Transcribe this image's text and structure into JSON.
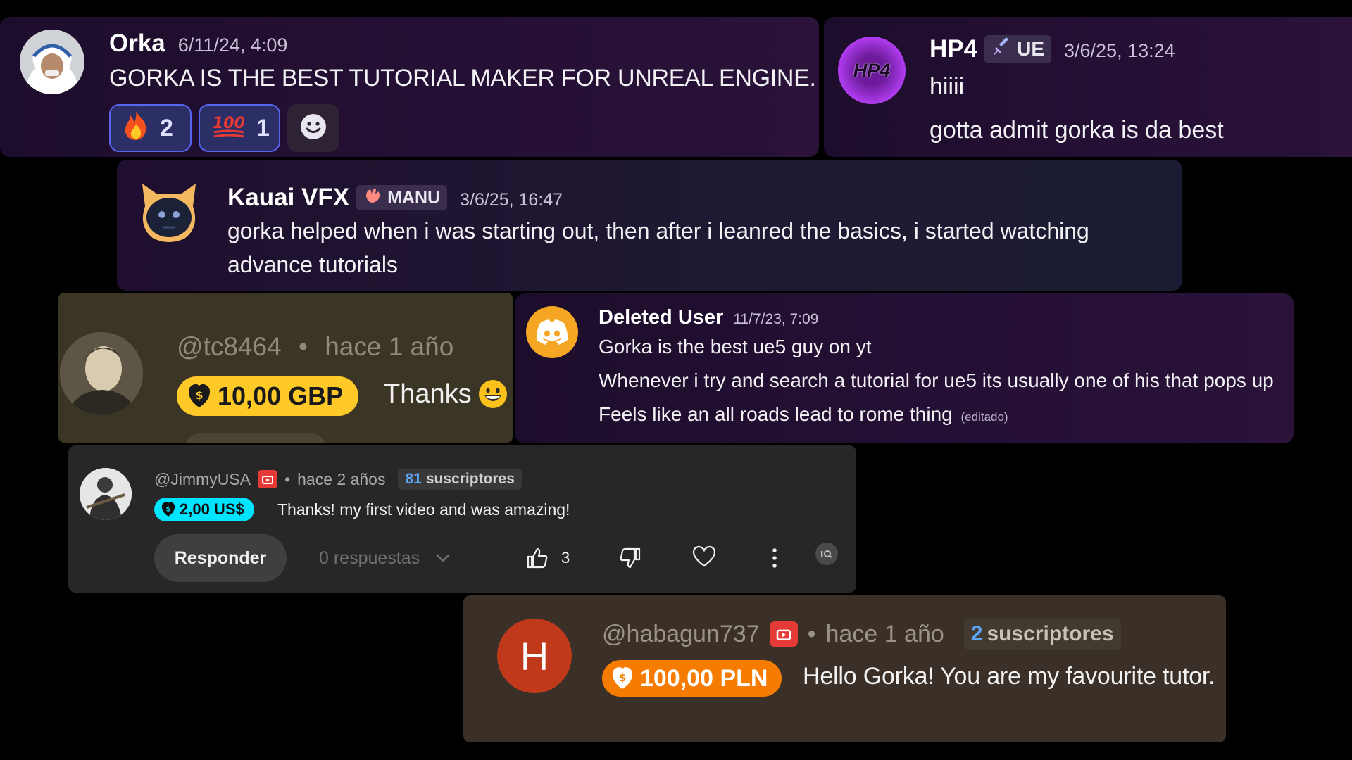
{
  "orka": {
    "name": "Orka",
    "timestamp": "6/11/24, 4:09",
    "message": "GORKA IS THE BEST TUTORIAL MAKER FOR UNREAL ENGINE.",
    "reactions": [
      {
        "icon": "fire-icon",
        "count": "2"
      },
      {
        "icon": "hundred-points-icon",
        "count": "1"
      }
    ]
  },
  "hp4": {
    "name": "HP4",
    "avatar_text": "HP4",
    "tag_icon": "sword-icon",
    "tag": "UE",
    "timestamp": "3/6/25, 13:24",
    "lines": [
      "hiiii",
      "gotta admit gorka is da best"
    ]
  },
  "kauai": {
    "name": "Kauai VFX",
    "tag_icon": "hand-icon",
    "tag": "MANU",
    "timestamp": "3/6/25, 16:47",
    "lines": [
      "gorka helped when i was starting out, then after i leanred the basics, i started watching",
      "advance tutorials"
    ]
  },
  "tc8464": {
    "handle": "@tc8464",
    "dot": "•",
    "time": "hace 1 año",
    "donation": "10,00 GBP",
    "message": "Thanks",
    "emoji": "grinning-face-icon"
  },
  "deleted_user": {
    "name": "Deleted User",
    "timestamp": "11/7/23, 7:09",
    "lines": [
      "Gorka is the best ue5 guy on yt",
      "Whenever i try and search a tutorial for ue5 its usually one of his that pops up",
      "Feels like an all roads lead to rome thing"
    ],
    "edited": "(editado)"
  },
  "jimmy": {
    "handle": "@JimmyUSA",
    "dot": "•",
    "time": "hace 2 años",
    "subs_count": "81",
    "subs_label": "suscriptores",
    "donation": "2,00 US$",
    "message": "Thanks! my first video and was amazing!",
    "reply_label": "Responder",
    "replies_label": "0 respuestas",
    "likes": "3"
  },
  "habagun": {
    "avatar_letter": "H",
    "handle": "@habagun737",
    "dot": "•",
    "time": "hace 1 año",
    "subs_count": "2",
    "subs_label": "suscriptores",
    "donation": "100,00 PLN",
    "message": "Hello Gorka! You are my favourite tutor."
  },
  "colors": {
    "discord_bg": "#241033",
    "discord_blurple": "#5865f2",
    "yt_dark": "#272727",
    "gbp_yellow": "#ffca28",
    "usd_cyan": "#00e5ff",
    "pln_orange": "#f57c00",
    "yt_red": "#e53a36"
  }
}
